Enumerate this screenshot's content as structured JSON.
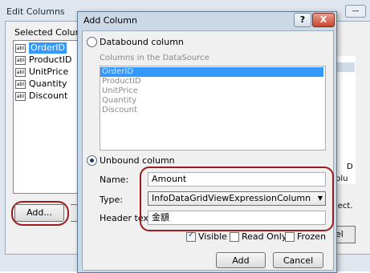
{
  "edit_columns": {
    "title": "Edit Columns",
    "selected_columns_label": "Selected Columns",
    "columns": [
      "OrderID",
      "ProductID",
      "UnitPrice",
      "Quantity",
      "Discount"
    ],
    "selected_index": 0,
    "add_button": "Add...",
    "partial_text_d": "D",
    "partial_text_plu": "plu",
    "partial_text_ject": "ject.",
    "partial_text_cancel": "el"
  },
  "add_column": {
    "title": "Add Column",
    "help_label": "?",
    "close_label": "X",
    "databound_label": "Databound column",
    "columns_in_datasource_label": "Columns in the DataSource",
    "datasource_columns": [
      "OrderID",
      "ProductID",
      "UnitPrice",
      "Quantity",
      "Discount"
    ],
    "unbound_label": "Unbound column",
    "name_label": "Name:",
    "name_value": "Amount",
    "type_label": "Type:",
    "type_value": "InfoDataGridViewExpressionColumn",
    "header_text_label": "Header text:",
    "header_text_value": "金額",
    "visible_label": "Visible",
    "visible_checked": true,
    "readonly_label": "Read Only",
    "readonly_checked": false,
    "frozen_label": "Frozen",
    "frozen_checked": false,
    "add_button": "Add",
    "cancel_button": "Cancel",
    "mode": "unbound"
  },
  "colors": {
    "selection": "#3399ff",
    "highlight_ring": "#9b1b1b",
    "close_button": "#c8452d"
  }
}
